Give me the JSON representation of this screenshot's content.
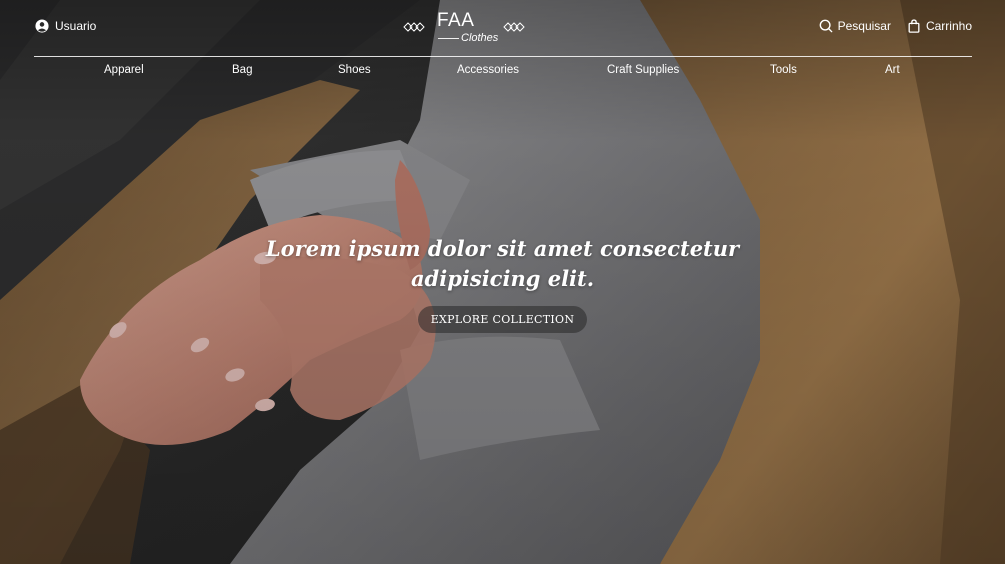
{
  "header": {
    "user_label": "Usuario",
    "search_label": "Pesquisar",
    "cart_label": "Carrinho"
  },
  "logo": {
    "title": "FAA",
    "subtitle": "Clothes"
  },
  "nav": {
    "items": [
      {
        "label": "Apparel"
      },
      {
        "label": "Bag"
      },
      {
        "label": "Shoes"
      },
      {
        "label": "Accessories"
      },
      {
        "label": "Craft Supplies"
      },
      {
        "label": "Tools"
      },
      {
        "label": "Art"
      }
    ]
  },
  "hero": {
    "headline": "Lorem ipsum dolor sit amet consectetur adipisicing elit.",
    "cta_label": "EXPLORE COLLECTION"
  },
  "icons": {
    "user": "user-circle-icon",
    "search": "search-icon",
    "cart": "shopping-bag-icon",
    "ornament": "diamond-ornament-icon"
  },
  "colors": {
    "text": "#ffffff",
    "coat": "#9a7449",
    "sweater": "#8a8a8c",
    "cta_bg": "#2b2b2b"
  }
}
